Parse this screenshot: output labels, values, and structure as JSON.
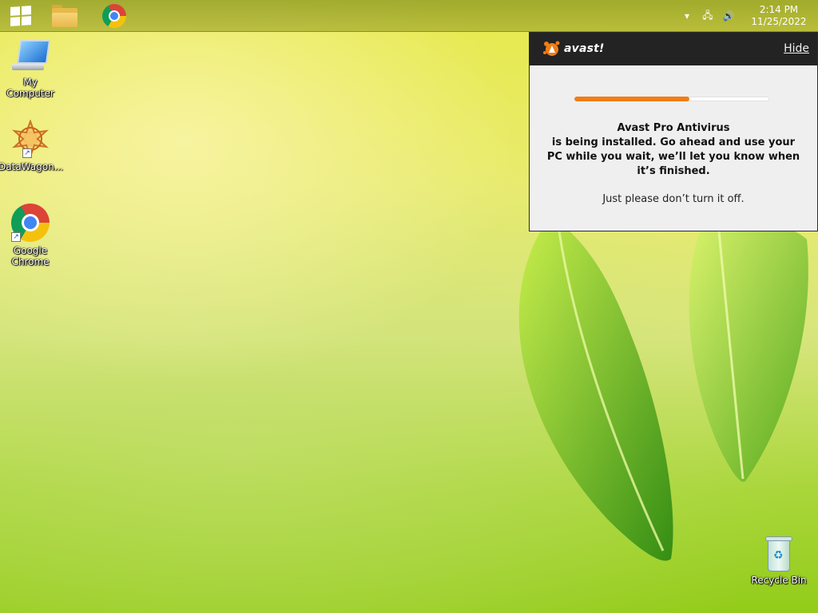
{
  "taskbar": {
    "start_label": "Start",
    "pinned": [
      {
        "name": "File Explorer",
        "icon": "folder-icon"
      },
      {
        "name": "Google Chrome",
        "icon": "chrome-icon"
      }
    ],
    "tray": {
      "clock_time": "2:14 PM",
      "clock_date": "11/25/2022"
    }
  },
  "desktop": {
    "icons": [
      {
        "label": "My Computer",
        "icon": "computer-icon"
      },
      {
        "label": "DataWagon...",
        "icon": "datawagon-icon"
      },
      {
        "label": "Google Chrome",
        "icon": "chrome-icon"
      },
      {
        "label": "Recycle Bin",
        "icon": "recycle-bin-icon"
      }
    ]
  },
  "avast_popup": {
    "brand": "avast!",
    "hide_label": "Hide",
    "progress": 0.59,
    "accent_color": "#f07d16",
    "message_line1": "Avast Pro Antivirus",
    "message_rest": "is being installed. Go ahead and use your PC while you wait, we’ll let you know when it’s finished.",
    "note": "Just please don’t turn it off."
  }
}
